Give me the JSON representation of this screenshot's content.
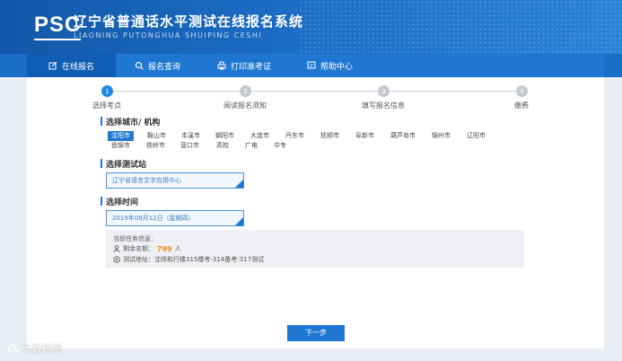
{
  "header": {
    "logo": "PSC",
    "title": "辽宁省普通话水平测试在线报名系统",
    "subtitle": "LIAONING PUTONGHUA SHUIPING CESHI"
  },
  "nav": {
    "items": [
      {
        "label": "在线报名",
        "icon": "edit-icon"
      },
      {
        "label": "报名查询",
        "icon": "search-icon"
      },
      {
        "label": "打印准考证",
        "icon": "printer-icon"
      },
      {
        "label": "帮助中心",
        "icon": "help-icon"
      }
    ]
  },
  "steps": [
    {
      "num": "1",
      "label": "选择考点"
    },
    {
      "num": "2",
      "label": "阅读报名须知"
    },
    {
      "num": "3",
      "label": "填写报名信息"
    },
    {
      "num": "4",
      "label": "缴费"
    }
  ],
  "city_section": {
    "title": "选择城市/ 机构",
    "cities": [
      "沈阳市",
      "鞍山市",
      "本溪市",
      "朝阳市",
      "大连市",
      "丹东市",
      "抚顺市",
      "阜新市",
      "葫芦岛市",
      "锦州市",
      "辽阳市",
      "盘锦市",
      "铁岭市",
      "营口市",
      "高校",
      "广电",
      "中专"
    ]
  },
  "station_section": {
    "title": "选择测试站",
    "value": "辽宁省语言文字应用中心"
  },
  "time_section": {
    "title": "选择时间",
    "value": "2019年09月12日（星期四）"
  },
  "info": {
    "header": "当前任务信息：",
    "remain_label": "剩余名额：",
    "remain_value": "799",
    "remain_unit": "人",
    "address": "测试地址：沈师和行楼315楼考-314备考-317测试"
  },
  "next_button": "下一步",
  "watermark": "大数跨境",
  "colors": {
    "primary": "#1f77d2",
    "remain": "#f08a1c"
  }
}
